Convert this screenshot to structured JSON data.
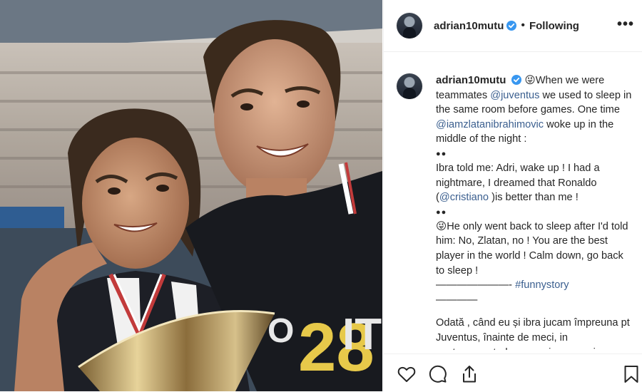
{
  "post": {
    "username": "adrian10mutu",
    "follow_status": "Following",
    "more_label": "•••"
  },
  "caption": {
    "username": "adrian10mutu",
    "emoji1": "😜",
    "line1_a": "When we were teammates ",
    "mention_juventus": "@juventus",
    "line1_b": " we used to sleep in the same room before games. One time ",
    "mention_zlatan": "@iamzlatanibrahimovic",
    "line1_c": " woke up in the middle of the night :",
    "bullets1": "●●",
    "para2_a": "Ibra told me: Adri, wake up ! I had a nightmare, I dreamed that Ronaldo (",
    "mention_cristiano": "@cristiano",
    "para2_b": " )is better than me !",
    "bullets2": "●●",
    "emoji2": "😜",
    "para3": "He only went back to sleep after I'd told him: No, Zlatan, no ! You are the best player in the world ! Calm down, go back to sleep !",
    "divider_a": "———————- ",
    "hashtag": "#funnystory",
    "divider_b": "————",
    "para4": "Odată , când eu și ibra jucam împreuna pt Juventus, înainte de meci, in cantonament, dormeam in aceeași"
  },
  "photo": {
    "shirt_number": "28",
    "shirt_text_left": "O",
    "shirt_text_right": "IT"
  },
  "actions": {
    "like": "heart-icon",
    "comment": "comment-icon",
    "share": "share-icon",
    "save": "bookmark-icon"
  },
  "colors": {
    "verified_blue": "#3897f0",
    "link": "#3b5f8f",
    "text": "#262626",
    "border": "#efefef"
  }
}
